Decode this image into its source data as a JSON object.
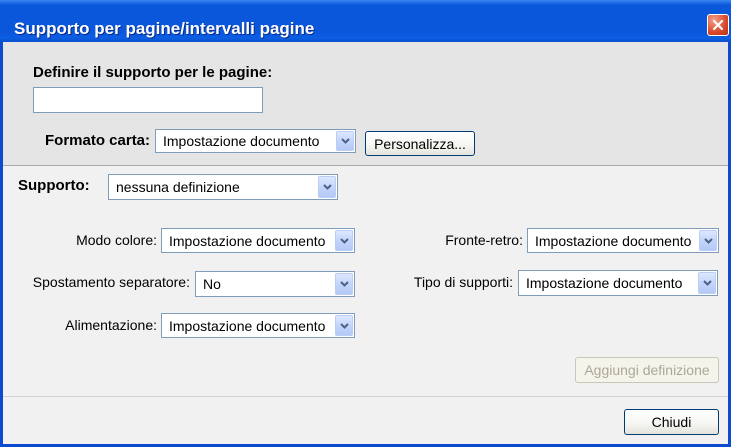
{
  "window": {
    "title": "Supporto per pagine/intervalli pagine"
  },
  "define": {
    "label": "Definire il supporto per le pagine:",
    "value": ""
  },
  "paper_size": {
    "label": "Formato carta:",
    "selected": "Impostazione documento",
    "customize_label": "Personalizza..."
  },
  "media": {
    "label": "Supporto:",
    "selected": "nessuna definizione"
  },
  "settings": {
    "color_mode": {
      "label": "Modo colore:",
      "selected": "Impostazione documento"
    },
    "duplex": {
      "label": "Fronte-retro:",
      "selected": "Impostazione documento"
    },
    "tab_shift": {
      "label": "Spostamento separatore:",
      "selected": "No"
    },
    "media_type": {
      "label": "Tipo di supporti:",
      "selected": "Impostazione documento"
    },
    "paper_source": {
      "label": "Alimentazione:",
      "selected": "Impostazione documento"
    }
  },
  "actions": {
    "add_definition_label": "Aggiungi definizione",
    "add_definition_enabled": false,
    "close_label": "Chiudi"
  },
  "icons": {
    "close": "close-icon",
    "dropdown": "chevron-down-icon"
  },
  "colors": {
    "title_bar": "#0a57dc",
    "close_button": "#d9482b",
    "top_panel": "#e5e5e5",
    "lower_panel": "#f1f1f1",
    "field_border": "#7f9db9",
    "button_border": "#003c74",
    "disabled_text": "#aca899",
    "window_frame": "#0b4bd0"
  }
}
